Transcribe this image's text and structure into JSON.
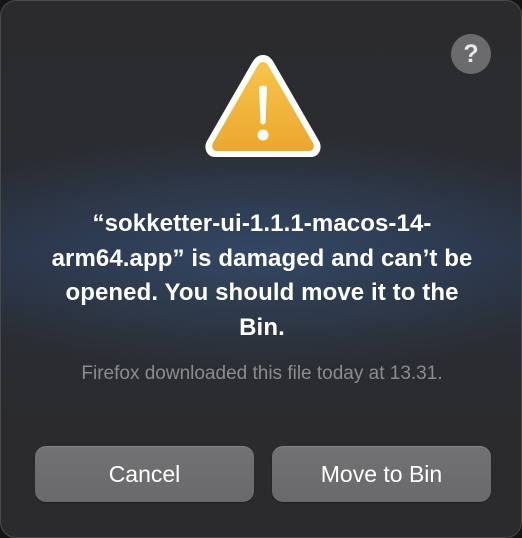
{
  "dialog": {
    "help_label": "?",
    "icon": "warning-triangle-icon",
    "title": "“sokketter-ui-1.1.1-macos-14-arm64.app” is damaged and can’t be opened. You should move it to the Bin.",
    "subtitle": "Firefox downloaded this file today at 13.31.",
    "cancel_label": "Cancel",
    "move_label": "Move to Bin"
  },
  "colors": {
    "warning_fill": "#f2b63c",
    "warning_border": "#ffffff",
    "button_bg": "#6b6b6d",
    "text_primary": "#ffffff",
    "text_secondary": "#8c8c8e"
  }
}
